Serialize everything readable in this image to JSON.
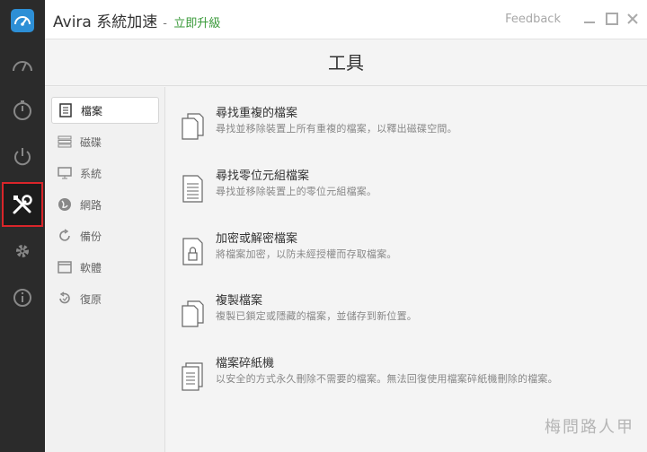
{
  "window": {
    "app_name": "Avira 系統加速",
    "separator": "-",
    "upgrade_link": "立即升級",
    "feedback": "Feedback"
  },
  "page": {
    "title": "工具"
  },
  "rail": {
    "items": [
      "speedometer-icon",
      "gauge-icon",
      "timer-icon",
      "power-icon",
      "tools-icon",
      "gear-icon",
      "info-icon"
    ],
    "active": "tools-icon"
  },
  "categories": [
    {
      "label": "檔案",
      "icon": "document-icon",
      "selected": true
    },
    {
      "label": "磁碟",
      "icon": "disk-icon",
      "selected": false
    },
    {
      "label": "系統",
      "icon": "monitor-icon",
      "selected": false
    },
    {
      "label": "網路",
      "icon": "globe-icon",
      "selected": false
    },
    {
      "label": "備份",
      "icon": "refresh-icon",
      "selected": false
    },
    {
      "label": "軟體",
      "icon": "window-icon",
      "selected": false
    },
    {
      "label": "復原",
      "icon": "restore-icon",
      "selected": false
    }
  ],
  "tools": [
    {
      "name": "尋找重複的檔案",
      "desc": "尋找並移除裝置上所有重複的檔案，以釋出磁碟空間。",
      "icon": "duplicate-files-icon"
    },
    {
      "name": "尋找零位元組檔案",
      "desc": "尋找並移除裝置上的零位元組檔案。",
      "icon": "zero-byte-file-icon"
    },
    {
      "name": "加密或解密檔案",
      "desc": "將檔案加密，以防未經授權而存取檔案。",
      "icon": "locked-file-icon"
    },
    {
      "name": "複製檔案",
      "desc": "複製已鎖定或隱藏的檔案，並儲存到新位置。",
      "icon": "copy-files-icon"
    },
    {
      "name": "檔案碎紙機",
      "desc": "以安全的方式永久刪除不需要的檔案。無法回復使用檔案碎紙機刪除的檔案。",
      "icon": "shredder-icon"
    }
  ],
  "watermark": "梅問路人甲",
  "colors": {
    "rail": "#2b2b2b",
    "active_border": "#d9252a",
    "upgrade": "#3a9a3a",
    "logo": "#2d8fd6"
  }
}
